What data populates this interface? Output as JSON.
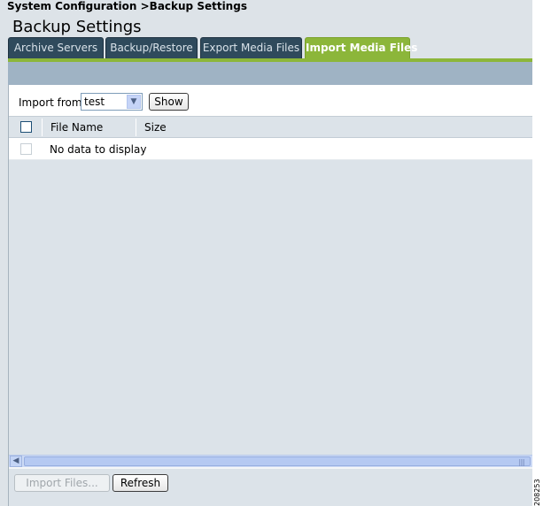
{
  "header": {
    "breadcrumb": "System Configuration >Backup Settings",
    "title": "Backup Settings"
  },
  "tabs": [
    {
      "label": "Archive Servers",
      "active": false
    },
    {
      "label": "Backup/Restore",
      "active": false
    },
    {
      "label": "Export Media Files",
      "active": false
    },
    {
      "label": "Import Media Files",
      "active": true
    }
  ],
  "import_bar": {
    "label": "Import from:",
    "selected_value": "test",
    "show_button": "Show"
  },
  "table": {
    "columns": [
      "File Name",
      "Size"
    ],
    "empty_text": "No data to display"
  },
  "footer": {
    "import_button": "Import Files...",
    "refresh_button": "Refresh"
  },
  "side_code": "208253",
  "colors": {
    "active_tab": "#8cb63a",
    "inactive_tab": "#2f4a5c",
    "band": "#9fb3c4",
    "content_bg": "#dce3e9"
  }
}
